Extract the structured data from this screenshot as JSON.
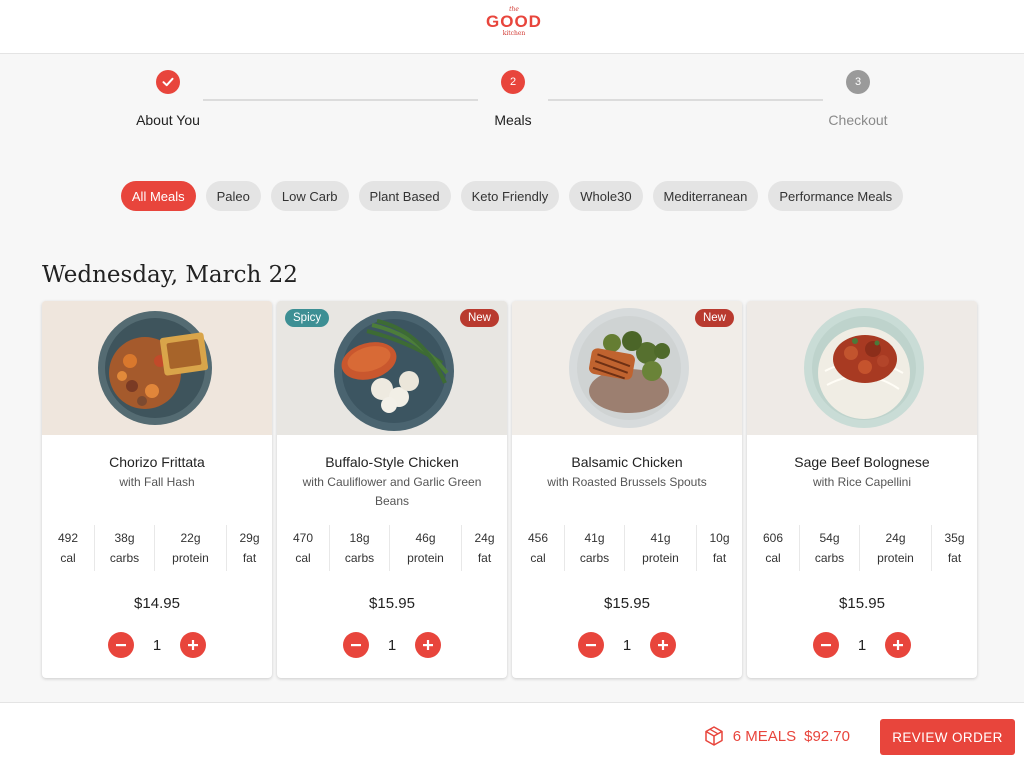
{
  "brand": {
    "tagline_top": "the",
    "name": "GOOD",
    "tagline_bottom": "kitchen"
  },
  "stepper": {
    "steps": [
      {
        "label": "About You",
        "status": "done",
        "marker": "check-icon"
      },
      {
        "label": "Meals",
        "status": "active",
        "number": "2"
      },
      {
        "label": "Checkout",
        "status": "pending",
        "number": "3"
      }
    ]
  },
  "filters": [
    "All Meals",
    "Paleo",
    "Low Carb",
    "Plant Based",
    "Keto Friendly",
    "Whole30",
    "Mediterranean",
    "Performance Meals"
  ],
  "active_filter": "All Meals",
  "date_heading": "Wednesday, March 22",
  "meals": [
    {
      "name": "Chorizo Frittata",
      "subtitle": "with Fall Hash",
      "badges": [],
      "cal": "492",
      "carbs": "38g",
      "protein": "22g",
      "fat": "29g",
      "price": "$14.95",
      "qty": "1"
    },
    {
      "name": "Buffalo-Style Chicken",
      "subtitle": "with Cauliflower and Garlic Green Beans",
      "badges": [
        "Spicy",
        "New"
      ],
      "cal": "470",
      "carbs": "18g",
      "protein": "46g",
      "fat": "24g",
      "price": "$15.95",
      "qty": "1"
    },
    {
      "name": "Balsamic Chicken",
      "subtitle": "with Roasted Brussels Spouts",
      "badges": [
        "New"
      ],
      "cal": "456",
      "carbs": "41g",
      "protein": "41g",
      "fat": "10g",
      "price": "$15.95",
      "qty": "1"
    },
    {
      "name": "Sage Beef Bolognese",
      "subtitle": "with Rice Capellini",
      "badges": [],
      "cal": "606",
      "carbs": "54g",
      "protein": "24g",
      "fat": "35g",
      "price": "$15.95",
      "qty": "1"
    }
  ],
  "nutrition_units": {
    "cal": "cal",
    "carbs": "carbs",
    "protein": "protein",
    "fat": "fat"
  },
  "cart": {
    "meals_label": "6 MEALS",
    "total": "$92.70",
    "review_label": "REVIEW ORDER"
  },
  "colors": {
    "accent": "#e8453c",
    "spicy": "#3d8f94",
    "new": "#b93a2f",
    "pending": "#9a9a9a"
  }
}
